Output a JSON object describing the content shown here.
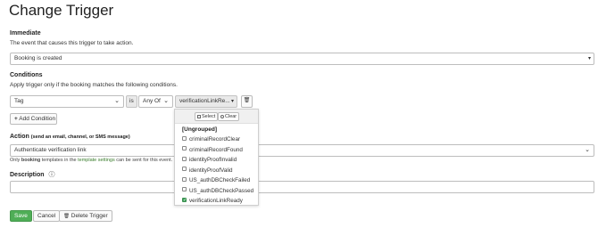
{
  "page": {
    "title": "Change Trigger"
  },
  "immediate": {
    "label": "Immediate",
    "help": "The event that causes this trigger to take action.",
    "event_value": "Booking is created",
    "caret": "▾"
  },
  "conditions": {
    "label": "Conditions",
    "help": "Apply trigger only if the booking matches the following conditions.",
    "field_value": "Tag",
    "operator_text": "is",
    "match_value": "Any Of",
    "values_value": "verificationLinkRe...",
    "add_condition_label": "Add Condition",
    "add_icon": "+",
    "chev": "⌄",
    "caret": "▾",
    "delete_icon_glyph": "🗑"
  },
  "dropdown": {
    "select_label": "Select",
    "clear_label": "Clear",
    "group_label": "[Ungrouped]",
    "options": [
      {
        "label": "criminalRecordClear",
        "checked": false
      },
      {
        "label": "criminalRecordFound",
        "checked": false
      },
      {
        "label": "identityProofInvalid",
        "checked": false
      },
      {
        "label": "identityProofValid",
        "checked": false
      },
      {
        "label": "US_authDBCheckFailed",
        "checked": false
      },
      {
        "label": "US_authDBCheckPassed",
        "checked": false
      },
      {
        "label": "verificationLinkReady",
        "checked": true
      }
    ],
    "check_glyph": "✓"
  },
  "action": {
    "label": "Action",
    "label_suffix": "(send an email, channel, or SMS message)",
    "value": "Authenticate verification link",
    "help_prefix": "Only ",
    "help_bold": "booking",
    "help_middle": " templates in the ",
    "help_link": "template settings",
    "help_suffix": " can be sent for this event.",
    "chev": "⌄"
  },
  "description": {
    "label": "Description",
    "info_icon": "ⓘ",
    "value": ""
  },
  "footer": {
    "save_label": "Save",
    "cancel_label": "Cancel",
    "delete_label": "Delete Trigger",
    "delete_icon_glyph": "🗑"
  },
  "colors": {
    "primary": "#4fae57",
    "link": "#3a7d2c",
    "checked": "#3ea15a"
  }
}
